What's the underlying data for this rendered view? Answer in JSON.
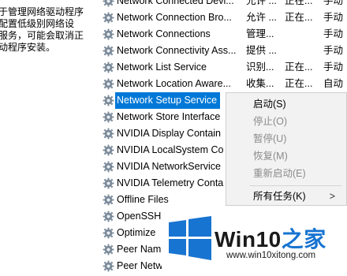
{
  "description": {
    "lines": [
      "于管理网络驱动程序",
      "配置低级别网络设",
      "服务，可能会取消正",
      "动程序安装。"
    ]
  },
  "services": [
    {
      "name": "Network Connected Devi...",
      "desc": "允许 ...",
      "status": "正在...",
      "startup": "手动"
    },
    {
      "name": "Network Connection Bro...",
      "desc": "允许 ...",
      "status": "正在...",
      "startup": "手动"
    },
    {
      "name": "Network Connections",
      "desc": "管理...",
      "status": "",
      "startup": "手动"
    },
    {
      "name": "Network Connectivity Ass...",
      "desc": "提供 ...",
      "status": "",
      "startup": "手动"
    },
    {
      "name": "Network List Service",
      "desc": "识别...",
      "status": "正在...",
      "startup": "手动"
    },
    {
      "name": "Network Location Aware...",
      "desc": "收集...",
      "status": "正在...",
      "startup": "自动"
    },
    {
      "name": "Network Setup Service",
      "desc": "",
      "status": "",
      "startup": "",
      "selected": true
    },
    {
      "name": "Network Store Interface",
      "desc": "",
      "status": "",
      "startup": ""
    },
    {
      "name": "NVIDIA Display Contain",
      "desc": "",
      "status": "",
      "startup": ""
    },
    {
      "name": "NVIDIA LocalSystem Co",
      "desc": "",
      "status": "",
      "startup": ""
    },
    {
      "name": "NVIDIA NetworkService",
      "desc": "",
      "status": "",
      "startup": ""
    },
    {
      "name": "NVIDIA Telemetry Conta",
      "desc": "",
      "status": "",
      "startup": ""
    },
    {
      "name": "Offline Files",
      "desc": "",
      "status": "",
      "startup": ""
    },
    {
      "name": "OpenSSH Authentication",
      "desc": "",
      "status": "",
      "startup": ""
    },
    {
      "name": "Optimize",
      "desc": "",
      "status": "",
      "startup": ""
    },
    {
      "name": "Peer Nam",
      "desc": "",
      "status": "",
      "startup": ""
    },
    {
      "name": "Peer Netw",
      "desc": "",
      "status": "",
      "startup": ""
    }
  ],
  "context_menu": {
    "start": "启动(S)",
    "stop": "停止(O)",
    "pause": "暂停(U)",
    "resume": "恢复(M)",
    "restart": "重新启动(E)",
    "all_tasks": "所有任务(K)",
    "submenu_arrow": ">"
  },
  "watermark": {
    "brand_a": "Win10",
    "brand_b": "之家",
    "url": "www.win10xitong.com",
    "logo_color": "#1874d1"
  }
}
